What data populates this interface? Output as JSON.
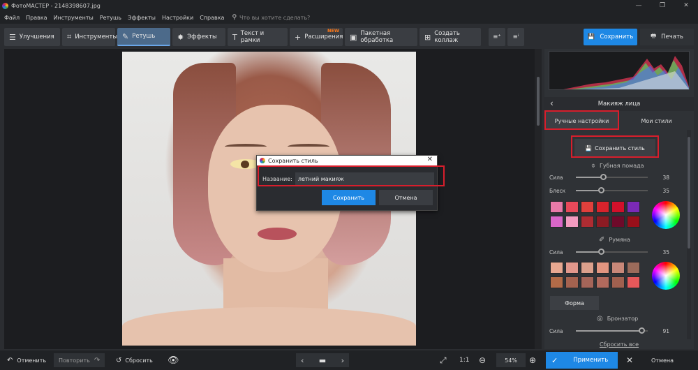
{
  "app": {
    "title": "ФотоМАСТЕР - 2148398607.jpg"
  },
  "menu": {
    "items": [
      "Файл",
      "Правка",
      "Инструменты",
      "Ретушь",
      "Эффекты",
      "Настройки",
      "Справка"
    ],
    "search_placeholder": "Что вы хотите сделать?"
  },
  "toolbar": {
    "tabs": [
      {
        "label": "Улучшения",
        "icon": "sliders-icon"
      },
      {
        "label": "Инструменты",
        "icon": "crop-icon"
      },
      {
        "label": "Ретушь",
        "icon": "brush-icon",
        "active": true
      },
      {
        "label": "Эффекты",
        "icon": "sparkle-icon"
      },
      {
        "label": "Текст и рамки",
        "icon": "text-icon"
      },
      {
        "label": "Расширения",
        "icon": "plus-icon",
        "badge": "NEW"
      },
      {
        "label": "Пакетная обработка",
        "icon": "image-stack-icon"
      },
      {
        "label": "Создать коллаж",
        "icon": "collage-icon"
      }
    ],
    "save_label": "Сохранить",
    "print_label": "Печать"
  },
  "panel": {
    "section_title": "Макияж лица",
    "tab_manual": "Ручные настройки",
    "tab_mystyles": "Мои стили",
    "save_style_label": "Сохранить стиль",
    "lipstick": {
      "title": "Губная помада",
      "sila_label": "Сила",
      "sila_value": "38",
      "sila_level": 0.38,
      "gloss_label": "Блеск",
      "gloss_value": "35",
      "gloss_level": 0.35
    },
    "blush": {
      "title": "Румяна",
      "sila_label": "Сила",
      "sila_value": "35",
      "sila_level": 0.35
    },
    "form_label": "Форма",
    "bronzer": {
      "title": "Бронзатор",
      "sila_label": "Сила",
      "sila_value": "91",
      "sila_level": 0.91
    },
    "reset_all": "Сбросить все",
    "lip_swatches": [
      "#e87aa8",
      "#e8495a",
      "#e0403c",
      "#d8232c",
      "#d2102a",
      "#7b2ab7",
      "#d966c8",
      "#f39bc0",
      "#ae2c32",
      "#8c1b23",
      "#6e0a2a",
      "#9a0f1a"
    ],
    "blush_swatches": [
      "#e8a891",
      "#e2988c",
      "#dca08c",
      "#e29580",
      "#c98879",
      "#9b6b5b",
      "#b26b48",
      "#a4624f",
      "#a56559",
      "#b16a5d",
      "#a0604f",
      "#e6585a"
    ]
  },
  "dialog": {
    "title": "Сохранить стиль",
    "name_label": "Название:",
    "name_value": "летний макияж",
    "ok_label": "Сохранить",
    "cancel_label": "Отмена"
  },
  "bottom": {
    "undo": "Отменить",
    "redo": "Повторить",
    "reset": "Сбросить",
    "ratio": "1:1",
    "zoom": "54%",
    "apply": "Применить",
    "cancel": "Отмена"
  }
}
